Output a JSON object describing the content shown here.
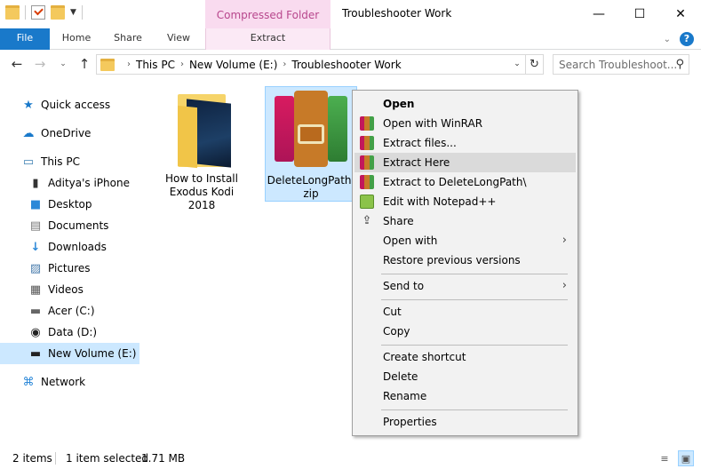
{
  "window": {
    "contextual_tab_group": "Compressed Folder Tools",
    "title": "Troubleshooter Work",
    "minimize": "—",
    "maximize": "☐",
    "close": "✕"
  },
  "ribbon": {
    "tabs": {
      "file": "File",
      "home": "Home",
      "share": "Share",
      "view": "View",
      "extract": "Extract"
    },
    "expand_chevron": "⌄",
    "help": "?"
  },
  "nav": {
    "back": "←",
    "forward": "→",
    "recent": "⌄",
    "up": "↑",
    "breadcrumbs": [
      "This PC",
      "New Volume (E:)",
      "Troubleshooter Work"
    ],
    "crumb_separator": "›",
    "dropdown": "⌄",
    "refresh": "↻",
    "search_placeholder": "Search Troubleshoot...",
    "search_icon": "⚲"
  },
  "sidebar": {
    "items": [
      {
        "label": "Quick access",
        "icon": "★",
        "icon_color": "#1979ca"
      },
      {
        "label": "OneDrive",
        "icon": "☁",
        "icon_color": "#1979ca"
      },
      {
        "label": "This PC",
        "icon": "▭",
        "icon_color": "#3c7fb1"
      },
      {
        "label": "Aditya's iPhone",
        "icon": "▮",
        "icon_color": "#333"
      },
      {
        "label": "Desktop",
        "icon": "■",
        "icon_color": "#2b88d8"
      },
      {
        "label": "Documents",
        "icon": "▤",
        "icon_color": "#777"
      },
      {
        "label": "Downloads",
        "icon": "↓",
        "icon_color": "#2b88d8"
      },
      {
        "label": "Pictures",
        "icon": "▨",
        "icon_color": "#4a7dad"
      },
      {
        "label": "Videos",
        "icon": "▦",
        "icon_color": "#555"
      },
      {
        "label": "Acer (C:)",
        "icon": "▬",
        "icon_color": "#666"
      },
      {
        "label": "Data (D:)",
        "icon": "◉",
        "icon_color": "#222"
      },
      {
        "label": "New Volume (E:)",
        "icon": "▬",
        "icon_color": "#222"
      },
      {
        "label": "Network",
        "icon": "⌘",
        "icon_color": "#2b88d8"
      }
    ]
  },
  "files": [
    {
      "label": "How to Install Exodus Kodi 2018"
    },
    {
      "label": "DeleteLongPath.zip"
    }
  ],
  "context_menu": {
    "items": [
      {
        "label": "Open"
      },
      {
        "label": "Open with WinRAR"
      },
      {
        "label": "Extract files..."
      },
      {
        "label": "Extract Here"
      },
      {
        "label": "Extract to DeleteLongPath\\"
      },
      {
        "label": "Edit with Notepad++"
      },
      {
        "label": "Share"
      },
      {
        "label": "Open with"
      },
      {
        "label": "Restore previous versions"
      },
      {
        "label": "Send to"
      },
      {
        "label": "Cut"
      },
      {
        "label": "Copy"
      },
      {
        "label": "Create shortcut"
      },
      {
        "label": "Delete"
      },
      {
        "label": "Rename"
      },
      {
        "label": "Properties"
      }
    ],
    "submenu_arrow": "›",
    "share_icon": "⇪"
  },
  "status": {
    "item_count": "2 items",
    "selection": "1 item selected",
    "size": "1.71 MB",
    "details_view_icon": "≡",
    "large_icons_view_icon": "▣"
  },
  "colors": {
    "accent": "#1979ca",
    "selection": "#cce8ff",
    "contextual_tab": "#f9dbef"
  }
}
